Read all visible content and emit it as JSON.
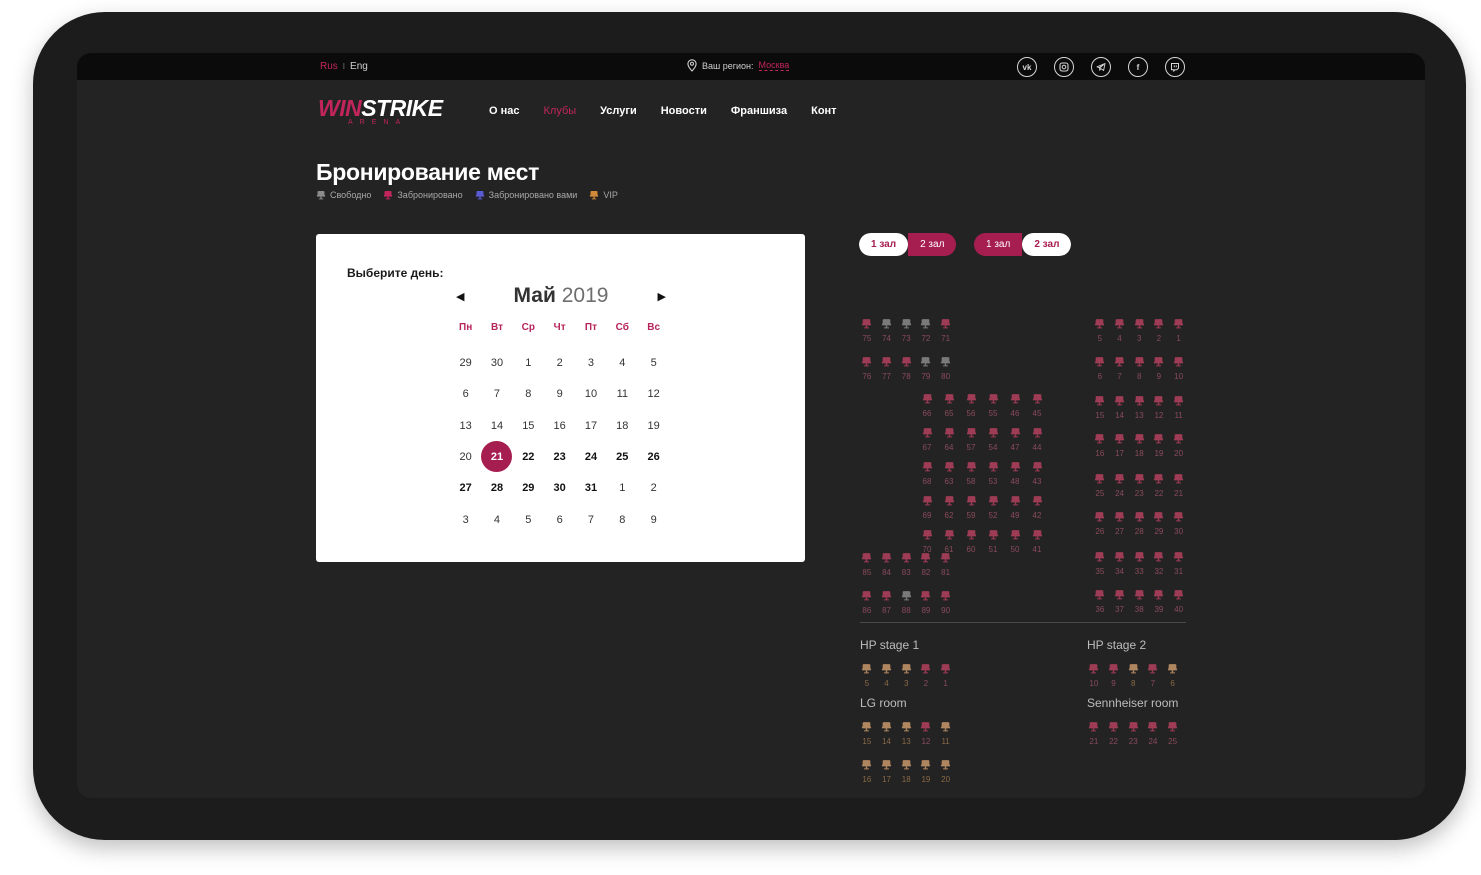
{
  "topbar": {
    "lang_active": "Rus",
    "lang_other": "Eng",
    "region_label": "Ваш регион:",
    "region_city": "Москва",
    "socials": [
      "vk-icon",
      "instagram-icon",
      "telegram-icon",
      "facebook-icon",
      "twitch-icon"
    ]
  },
  "logo": {
    "win": "WIN",
    "strike": "STRIKE",
    "sub": "ARENA"
  },
  "nav": [
    {
      "label": "О нас",
      "active": false
    },
    {
      "label": "Клубы",
      "active": true
    },
    {
      "label": "Услуги",
      "active": false
    },
    {
      "label": "Новости",
      "active": false
    },
    {
      "label": "Франшиза",
      "active": false
    },
    {
      "label": "Конт",
      "active": false
    }
  ],
  "page": {
    "title": "Бронирование мест",
    "legend": [
      {
        "label": "Свободно",
        "color": "#8a8a8a"
      },
      {
        "label": "Забронировано",
        "color": "#c2255c"
      },
      {
        "label": "Забронировано вами",
        "color": "#5b5bd6"
      },
      {
        "label": "VIP",
        "color": "#d18a3a"
      }
    ]
  },
  "calendar": {
    "label": "Выберите день:",
    "month": "Май",
    "year": "2019",
    "weekdays": [
      "Пн",
      "Вт",
      "Ср",
      "Чт",
      "Пт",
      "Сб",
      "Вс"
    ],
    "weeks": [
      [
        "29",
        "30",
        "1",
        "2",
        "3",
        "4",
        "5"
      ],
      [
        "6",
        "7",
        "8",
        "9",
        "10",
        "11",
        "12"
      ],
      [
        "13",
        "14",
        "15",
        "16",
        "17",
        "18",
        "19"
      ],
      [
        "20",
        "21",
        "22",
        "23",
        "24",
        "25",
        "26"
      ],
      [
        "27",
        "28",
        "29",
        "30",
        "31",
        "1",
        "2"
      ],
      [
        "3",
        "4",
        "5",
        "6",
        "7",
        "8",
        "9"
      ]
    ],
    "selected": "21",
    "available_from_index": [
      3,
      1
    ]
  },
  "hall_tabs": [
    {
      "items": [
        {
          "label": "1 зал",
          "style": "white"
        },
        {
          "label": "2 зал",
          "style": "pink"
        }
      ]
    },
    {
      "items": [
        {
          "label": "1 зал",
          "style": "pink"
        },
        {
          "label": "2 зал",
          "style": "white"
        }
      ]
    }
  ],
  "seat_map": {
    "colors": {
      "booked": "#9e3b55",
      "free": "#7a7a7a",
      "vip": "#b08660",
      "vip_booked": "#9e3b55"
    },
    "blocks": [
      {
        "rows": [
          [
            [
              "75",
              "booked"
            ],
            [
              "74",
              "free"
            ],
            [
              "73",
              "free"
            ],
            [
              "72",
              "free"
            ],
            [
              "71",
              "booked"
            ]
          ],
          [
            [
              "76",
              "booked"
            ],
            [
              "77",
              "booked"
            ],
            [
              "78",
              "booked"
            ],
            [
              "79",
              "free"
            ],
            [
              "80",
              "free"
            ]
          ]
        ]
      },
      {
        "rows": [
          [
            [
              "5",
              "booked"
            ],
            [
              "4",
              "booked"
            ],
            [
              "3",
              "booked"
            ],
            [
              "2",
              "booked"
            ],
            [
              "1",
              "booked"
            ]
          ],
          [
            [
              "6",
              "booked"
            ],
            [
              "7",
              "booked"
            ],
            [
              "8",
              "booked"
            ],
            [
              "9",
              "booked"
            ],
            [
              "10",
              "booked"
            ]
          ]
        ]
      },
      {
        "rows": [
          [
            [
              "66",
              "booked"
            ],
            [
              "65",
              "booked"
            ],
            [
              "56",
              "booked"
            ],
            [
              "55",
              "booked"
            ],
            [
              "46",
              "booked"
            ],
            [
              "45",
              "booked"
            ]
          ],
          [
            [
              "67",
              "booked"
            ],
            [
              "64",
              "booked"
            ],
            [
              "57",
              "booked"
            ],
            [
              "54",
              "booked"
            ],
            [
              "47",
              "booked"
            ],
            [
              "44",
              "booked"
            ]
          ],
          [
            [
              "68",
              "booked"
            ],
            [
              "63",
              "booked"
            ],
            [
              "58",
              "booked"
            ],
            [
              "53",
              "booked"
            ],
            [
              "48",
              "booked"
            ],
            [
              "43",
              "booked"
            ]
          ],
          [
            [
              "69",
              "booked"
            ],
            [
              "62",
              "booked"
            ],
            [
              "59",
              "booked"
            ],
            [
              "52",
              "booked"
            ],
            [
              "49",
              "booked"
            ],
            [
              "42",
              "booked"
            ]
          ],
          [
            [
              "70",
              "booked"
            ],
            [
              "61",
              "booked"
            ],
            [
              "60",
              "booked"
            ],
            [
              "51",
              "booked"
            ],
            [
              "50",
              "booked"
            ],
            [
              "41",
              "booked"
            ]
          ]
        ]
      },
      {
        "rows": [
          [
            [
              "15",
              "booked"
            ],
            [
              "14",
              "booked"
            ],
            [
              "13",
              "booked"
            ],
            [
              "12",
              "booked"
            ],
            [
              "11",
              "booked"
            ]
          ],
          [
            [
              "16",
              "booked"
            ],
            [
              "17",
              "booked"
            ],
            [
              "18",
              "booked"
            ],
            [
              "19",
              "booked"
            ],
            [
              "20",
              "booked"
            ]
          ]
        ]
      },
      {
        "rows": [
          [
            [
              "25",
              "booked"
            ],
            [
              "24",
              "booked"
            ],
            [
              "23",
              "booked"
            ],
            [
              "22",
              "booked"
            ],
            [
              "21",
              "booked"
            ]
          ],
          [
            [
              "26",
              "booked"
            ],
            [
              "27",
              "booked"
            ],
            [
              "28",
              "booked"
            ],
            [
              "29",
              "booked"
            ],
            [
              "30",
              "booked"
            ]
          ]
        ]
      },
      {
        "rows": [
          [
            [
              "85",
              "booked"
            ],
            [
              "84",
              "booked"
            ],
            [
              "83",
              "booked"
            ],
            [
              "82",
              "booked"
            ],
            [
              "81",
              "booked"
            ]
          ],
          [
            [
              "86",
              "booked"
            ],
            [
              "87",
              "booked"
            ],
            [
              "88",
              "free"
            ],
            [
              "89",
              "booked"
            ],
            [
              "90",
              "booked"
            ]
          ]
        ]
      },
      {
        "rows": [
          [
            [
              "35",
              "booked"
            ],
            [
              "34",
              "booked"
            ],
            [
              "33",
              "booked"
            ],
            [
              "32",
              "booked"
            ],
            [
              "31",
              "booked"
            ]
          ],
          [
            [
              "36",
              "booked"
            ],
            [
              "37",
              "booked"
            ],
            [
              "38",
              "booked"
            ],
            [
              "39",
              "booked"
            ],
            [
              "40",
              "booked"
            ]
          ]
        ]
      }
    ],
    "rooms": [
      {
        "name": "HP stage 1",
        "rows": [
          [
            [
              "5",
              "vip"
            ],
            [
              "4",
              "vip"
            ],
            [
              "3",
              "vip"
            ],
            [
              "2",
              "booked"
            ],
            [
              "1",
              "booked"
            ]
          ]
        ]
      },
      {
        "name": "HP stage 2",
        "rows": [
          [
            [
              "10",
              "booked"
            ],
            [
              "9",
              "booked"
            ],
            [
              "8",
              "vip"
            ],
            [
              "7",
              "booked"
            ],
            [
              "6",
              "vip"
            ]
          ]
        ]
      },
      {
        "name": "LG room",
        "rows": [
          [
            [
              "15",
              "vip"
            ],
            [
              "14",
              "vip"
            ],
            [
              "13",
              "vip"
            ],
            [
              "12",
              "booked"
            ],
            [
              "11",
              "vip"
            ]
          ],
          [
            [
              "16",
              "vip"
            ],
            [
              "17",
              "vip"
            ],
            [
              "18",
              "vip"
            ],
            [
              "19",
              "vip"
            ],
            [
              "20",
              "vip"
            ]
          ]
        ]
      },
      {
        "name": "Sennheiser room",
        "rows": [
          [
            [
              "21",
              "booked"
            ],
            [
              "22",
              "booked"
            ],
            [
              "23",
              "booked"
            ],
            [
              "24",
              "booked"
            ],
            [
              "25",
              "booked"
            ]
          ]
        ]
      }
    ]
  }
}
